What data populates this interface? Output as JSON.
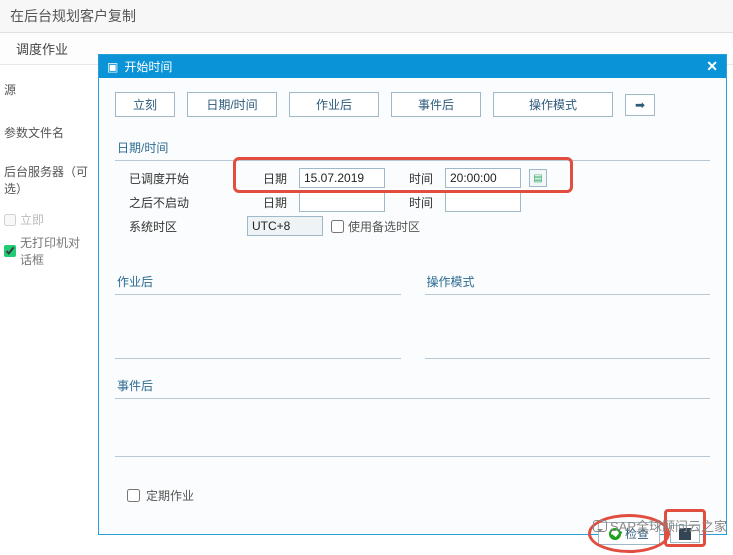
{
  "page": {
    "main_title": "在后台规划客户复制",
    "sub_title": "调度作业"
  },
  "left_panel": {
    "source_label": "源",
    "param_file_label": "参数文件名",
    "bg_server_label": "后台服务器（可选）",
    "chk_immediate_label": "立即",
    "chk_noprinter_label": "无打印机对话框"
  },
  "modal": {
    "title": "开始时间",
    "tabs": {
      "immediate": "立刻",
      "datetime": "日期/时间",
      "after_job": "作业后",
      "after_event": "事件后",
      "op_mode": "操作模式"
    },
    "section_datetime": "日期/时间",
    "section_afterjob": "作业后",
    "section_opmode": "操作模式",
    "section_afterevent": "事件后",
    "rows": {
      "scheduled_start": "已调度开始",
      "no_start_after": "之后不启动",
      "system_tz": "系统时区",
      "date_label": "日期",
      "time_label": "时间",
      "date_value": "15.07.2019",
      "time_value": "20:00:00",
      "tz_value": "UTC+8",
      "alt_tz_label": "使用备选时区"
    },
    "periodic_label": "定期作业",
    "actions": {
      "check": "检查"
    }
  },
  "watermark": "SAP全球顾问云之家"
}
